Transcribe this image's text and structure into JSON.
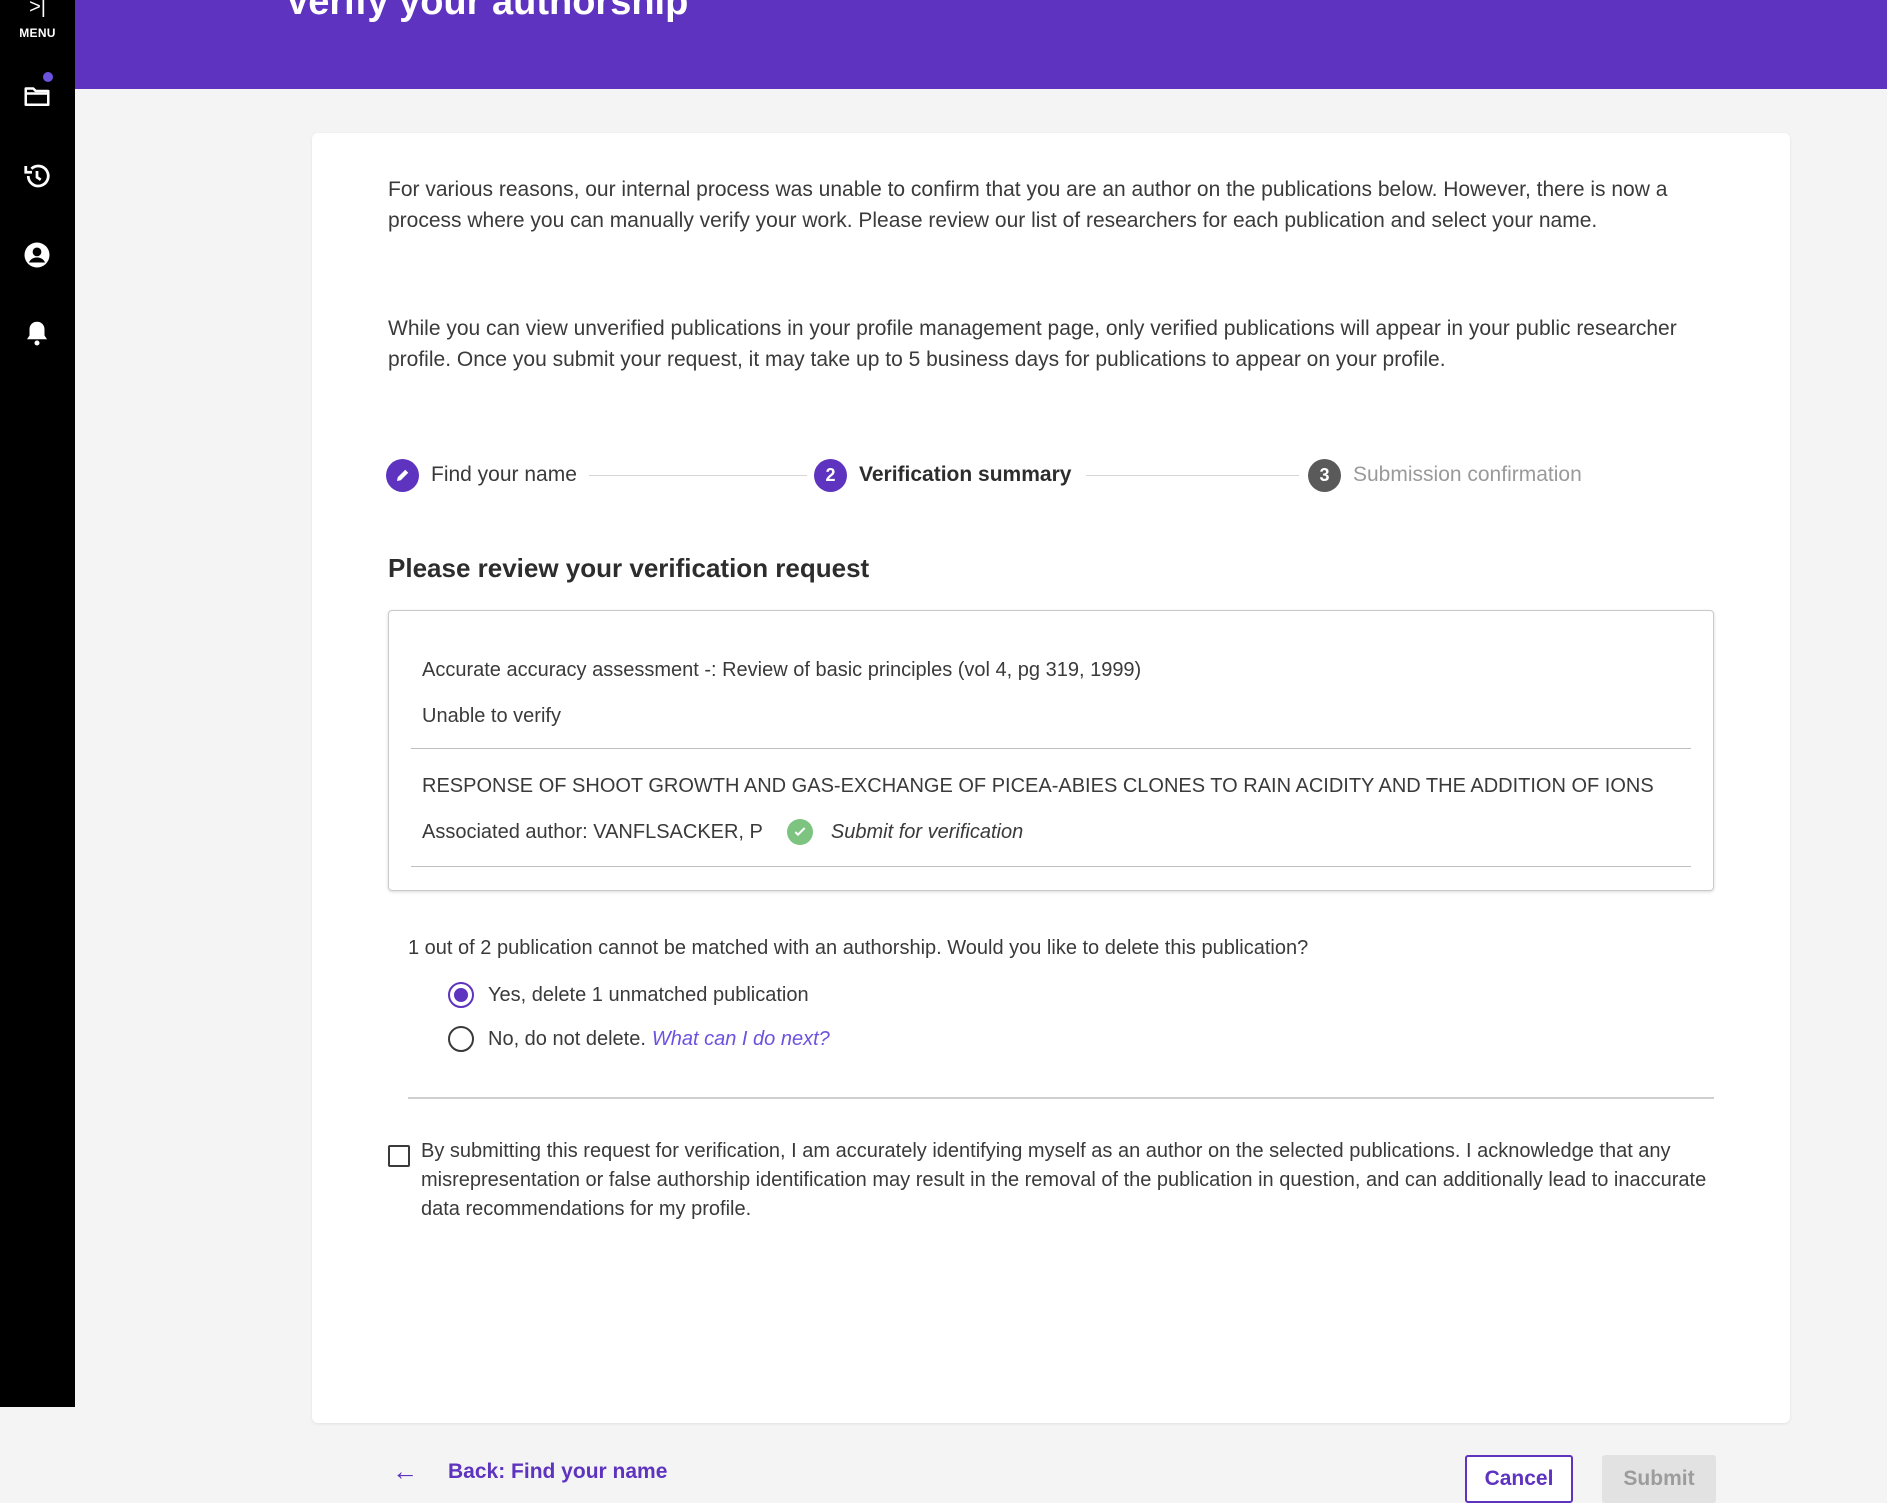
{
  "sidebar": {
    "menu_arrow": ">|",
    "menu_label": "MENU",
    "icons": [
      "folder-icon",
      "history-icon",
      "account-icon",
      "bell-icon"
    ]
  },
  "header": {
    "title": "Verify your authorship"
  },
  "intro": {
    "paragraph1": "For various reasons, our internal process was unable to confirm that you are an author on the publications below. However, there is now a process where you can manually verify your work. Please review our list of researchers for each publication and select your name.",
    "paragraph2": "While you can view unverified publications in your profile management page, only verified publications will appear in your public researcher profile. Once you submit your request, it may take up to 5 business days for publications to appear on your profile."
  },
  "stepper": {
    "steps": [
      {
        "number": "",
        "label": "Find your name",
        "state": "completed"
      },
      {
        "number": "2",
        "label": "Verification summary",
        "state": "active"
      },
      {
        "number": "3",
        "label": "Submission confirmation",
        "state": "upcoming"
      }
    ]
  },
  "review": {
    "title": "Please review your verification request",
    "publications": [
      {
        "title": "Accurate accuracy assessment -: Review of basic principles (vol 4, pg 319, 1999)",
        "status": "Unable to verify"
      },
      {
        "title": "RESPONSE OF SHOOT GROWTH AND GAS-EXCHANGE OF PICEA-ABIES CLONES TO RAIN ACIDITY AND THE ADDITION OF IONS",
        "author": "Associated author: VANFLSACKER, P",
        "status": "Submit for verification"
      }
    ]
  },
  "unmatched": {
    "question": "1 out of 2 publication cannot be matched with an authorship. Would you like to delete this publication?",
    "option_yes": "Yes, delete 1 unmatched publication",
    "option_no": "No, do not delete.",
    "option_no_link": "What can I do next?",
    "selected": "yes"
  },
  "acknowledgement": {
    "text": "By submitting this request for verification, I am accurately identifying myself as an author on the selected publications. I acknowledge that any misrepresentation or false authorship identification may result in the removal of the publication in question, and can additionally lead to inaccurate data recommendations for my profile.",
    "checked": false
  },
  "footer": {
    "back_label": "Back: Find your name",
    "back_arrow": "←",
    "cancel_label": "Cancel",
    "submit_label": "Submit"
  },
  "colors": {
    "brand": "#5e33bf",
    "link": "#6d52e0",
    "success": "#7cc47f",
    "sidebar": "#000000"
  }
}
